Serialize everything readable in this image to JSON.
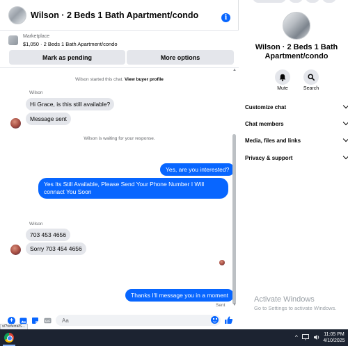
{
  "header": {
    "title": "Wilson · 2 Beds 1 Bath Apartment/condo",
    "info_icon": "info-icon"
  },
  "marketplace": {
    "label": "Marketplace",
    "item": "$1,050 · 2 Beds 1 Bath Apartment/condo",
    "mark_pending": "Mark as pending",
    "more_options": "More options"
  },
  "messages": {
    "system_started_prefix": "Wilson started this chat.",
    "system_started_link": "View buyer profile",
    "sender1": "Wilson",
    "in1": "Hi Grace, is this still available?",
    "in2": "Message sent",
    "system_waiting": "Wilson is waiting for your response.",
    "out1": "Yes, are you interested?",
    "out2": "Yes Its Still Available, Please Send Your Phone Number I Will connact You Soon",
    "sender2": "Wilson",
    "in3": "703 453 4656",
    "in4": "Sorry 703 454 4656",
    "out3": "Thanks I'll message you in a moment",
    "sent_status": "Sent"
  },
  "composer": {
    "placeholder": "Aa",
    "status_url": "s/?referralS..."
  },
  "panel": {
    "name": "Wilson · 2 Beds 1 Bath Apartment/condo",
    "mute_label": "Mute",
    "search_label": "Search",
    "menu": [
      {
        "label": "Customize chat"
      },
      {
        "label": "Chat members"
      },
      {
        "label": "Media, files and links"
      },
      {
        "label": "Privacy & support"
      }
    ]
  },
  "watermark": {
    "title": "Activate Windows",
    "subtitle": "Go to Settings to activate Windows."
  },
  "taskbar": {
    "time": "11:05 PM",
    "date": "4/10/2025",
    "tray_up": "^"
  },
  "colors": {
    "accent": "#0866ff",
    "bubble_in": "#e4e6eb"
  }
}
